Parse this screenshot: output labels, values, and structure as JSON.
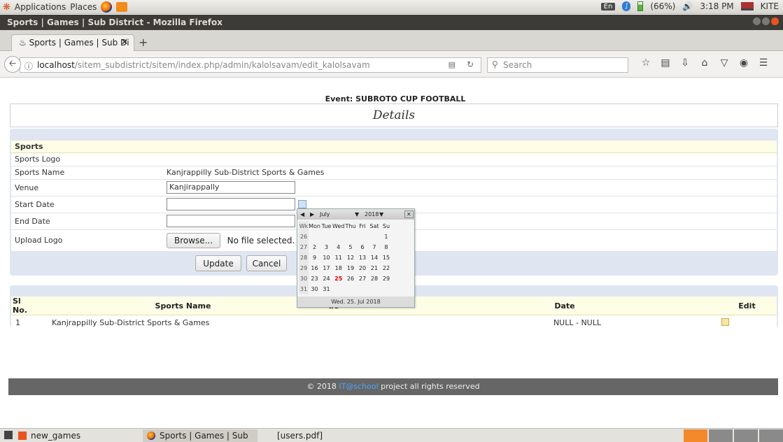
{
  "system_panel": {
    "applications": "Applications",
    "places": "Places",
    "keyboard": "En",
    "battery": "(66%)",
    "time": "3:18 PM",
    "user": "KITE"
  },
  "window": {
    "title": "Sports | Games | Sub District - Mozilla Firefox"
  },
  "browser": {
    "tab_label": "Sports | Games | Sub Di",
    "url_host": "localhost",
    "url_path": "/sitem_subdistrict/sitem/index.php/admin/kalolsavam/edit_kalolsavam",
    "search_placeholder": "Search"
  },
  "page": {
    "event_title": "Event: SUBROTO CUP FOOTBALL",
    "details_heading": "Details",
    "form": {
      "section_label": "Sports",
      "logo_label": "Sports Logo",
      "name_label": "Sports Name",
      "name_value": "Kanjrappilly Sub-District Sports & Games",
      "venue_label": "Venue",
      "venue_value": "Kanjirappally",
      "start_label": "Start Date",
      "end_label": "End Date",
      "upload_label": "Upload Logo",
      "browse_label": "Browse...",
      "nofile_text": "No file selected.",
      "update_label": "Update",
      "cancel_label": "Cancel"
    },
    "list": {
      "headers": [
        "Sl No.",
        "Sports Name",
        "ue",
        "Date",
        "Edit"
      ],
      "rows": [
        {
          "sl": "1",
          "name": "Kanjrappilly Sub-District Sports & Games",
          "date": "NULL  -  NULL"
        }
      ]
    },
    "calendar": {
      "month": "July",
      "year": "2018",
      "day_headers": [
        "Wk",
        "Mon",
        "Tue",
        "Wed",
        "Thu",
        "Fri",
        "Sat",
        "Su"
      ],
      "weeks": [
        [
          "26",
          "",
          "",
          "",
          "",
          "",
          "",
          "1"
        ],
        [
          "27",
          "2",
          "3",
          "4",
          "5",
          "6",
          "7",
          "8"
        ],
        [
          "28",
          "9",
          "10",
          "11",
          "12",
          "13",
          "14",
          "15"
        ],
        [
          "29",
          "16",
          "17",
          "18",
          "19",
          "20",
          "21",
          "22"
        ],
        [
          "30",
          "23",
          "24",
          "25",
          "26",
          "27",
          "28",
          "29"
        ],
        [
          "31",
          "30",
          "31",
          "",
          "",
          "",
          "",
          ""
        ]
      ],
      "today": "25",
      "footer": "Wed. 25. Jul 2018"
    },
    "footer": {
      "prefix": "© 2018 ",
      "link": "IT@school",
      "suffix": " project all rights reserved"
    }
  },
  "taskbar": {
    "items": [
      "new_games",
      "Sports | Games | Sub ...",
      "[users.pdf]"
    ]
  }
}
